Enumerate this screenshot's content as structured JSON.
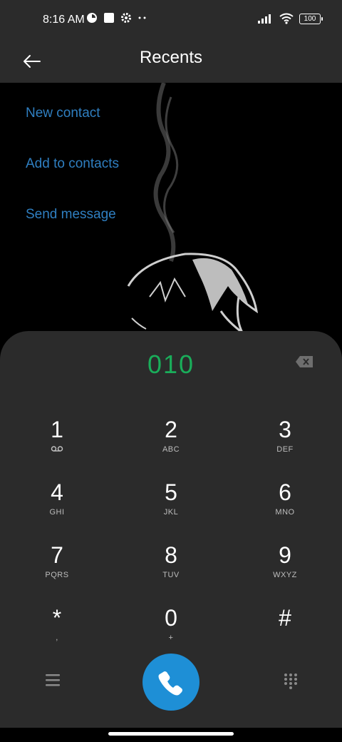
{
  "status_bar": {
    "time": "8:16 AM",
    "left_icons": [
      "notification-icon",
      "square-icon",
      "gear-icon",
      "more-dots-icon"
    ],
    "battery": "100",
    "right_icons": [
      "signal-icon",
      "wifi-icon",
      "battery-icon"
    ]
  },
  "header": {
    "title": "Recents",
    "back_icon": "arrow-left-icon"
  },
  "actions": {
    "new_contact": "New contact",
    "add_to_contacts": "Add to contacts",
    "send_message": "Send message"
  },
  "dialpad": {
    "entered_number": "010",
    "number_color": "#1aad5a",
    "keys": [
      {
        "digit": "1",
        "letters": "voicemail-icon"
      },
      {
        "digit": "2",
        "letters": "ABC"
      },
      {
        "digit": "3",
        "letters": "DEF"
      },
      {
        "digit": "4",
        "letters": "GHI"
      },
      {
        "digit": "5",
        "letters": "JKL"
      },
      {
        "digit": "6",
        "letters": "MNO"
      },
      {
        "digit": "7",
        "letters": "PQRS"
      },
      {
        "digit": "8",
        "letters": "TUV"
      },
      {
        "digit": "9",
        "letters": "WXYZ"
      },
      {
        "digit": "*",
        "letters": ","
      },
      {
        "digit": "0",
        "letters": "+"
      },
      {
        "digit": "#",
        "letters": ""
      }
    ],
    "call_color": "#1e8fd6"
  },
  "bottom_bar": {
    "menu_icon": "menu-icon",
    "call_icon": "phone-icon",
    "keypad_icon": "dialpad-grid-icon"
  }
}
